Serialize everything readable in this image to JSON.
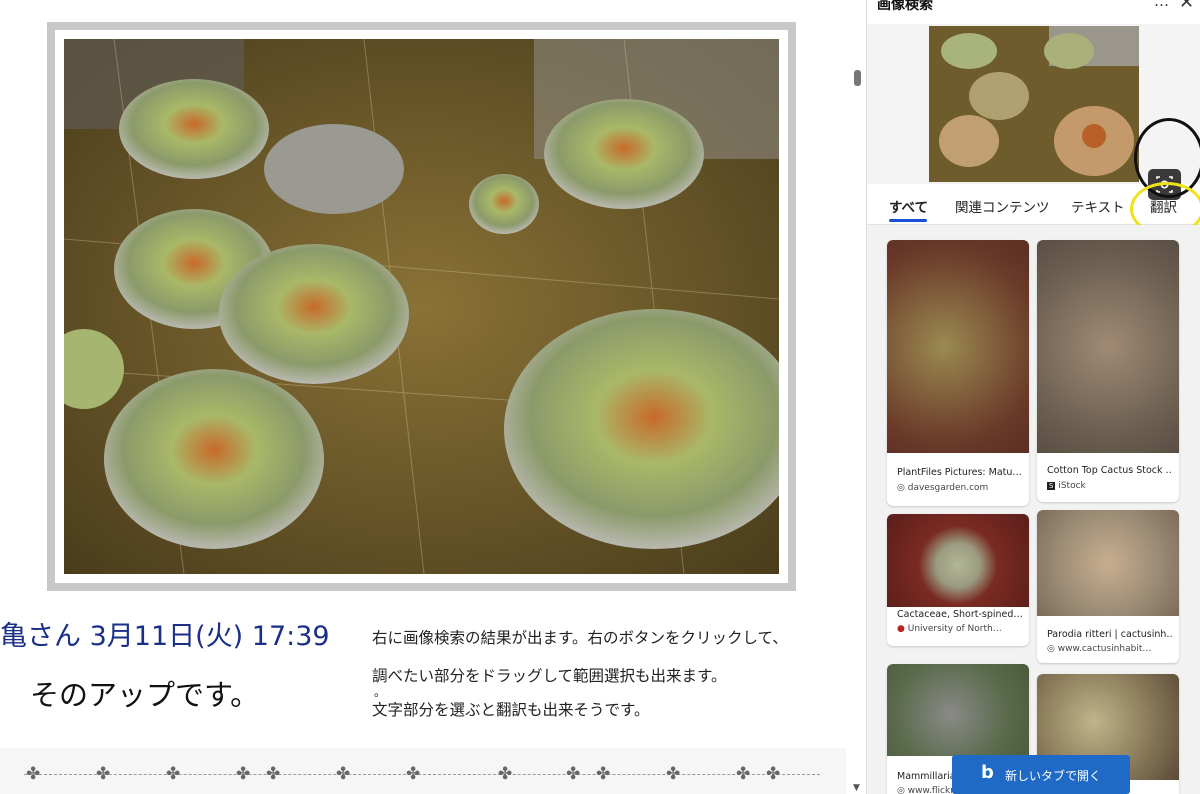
{
  "comment": {
    "author_line": "亀さん 3月11日(火) 17:39",
    "body": "そのアップです。"
  },
  "note": {
    "line1": "右に画像検索の結果が出ます。右のボタンをクリックして、",
    "line2": "調べたい部分をドラッグして範囲選択も出来ます。",
    "line3": "。",
    "line4": " 文字部分を選ぶと翻訳も出来そうです。"
  },
  "panel": {
    "title": "画像検索",
    "more_icon": "…",
    "close_icon": "✕",
    "tabs": [
      {
        "label": "すべて",
        "active": true
      },
      {
        "label": "関連コンテンツ",
        "active": false
      },
      {
        "label": "テキスト",
        "active": false
      },
      {
        "label": "翻訳",
        "active": false
      }
    ],
    "results": [
      {
        "title": "PlantFiles Pictures: Matu…",
        "source": "davesgarden.com",
        "source_icon": "globe-icon"
      },
      {
        "title": "Cotton Top Cactus Stock …",
        "source": "iStock",
        "source_icon": "istock-icon"
      },
      {
        "title": "Cactaceae, Short-spined…",
        "source": "University of North…",
        "source_icon": "university-icon"
      },
      {
        "title": "Parodia ritteri | cactusinh…",
        "source": "www.cactusinhabit…",
        "source_icon": "globe-icon"
      },
      {
        "title": "Mammillaria…",
        "source": "www.flickr.com",
        "source_icon": "globe-icon"
      },
      {
        "title": "",
        "source": "",
        "source_icon": ""
      }
    ],
    "new_tab_button": "新しいタブで開く",
    "bing_icon": "b"
  },
  "colors": {
    "accent_blue": "#1a4fd8",
    "button_blue": "#1f6ac7",
    "author_blue": "#1a2f88",
    "annotation_black": "#111111",
    "annotation_yellow": "#f1e11a"
  }
}
